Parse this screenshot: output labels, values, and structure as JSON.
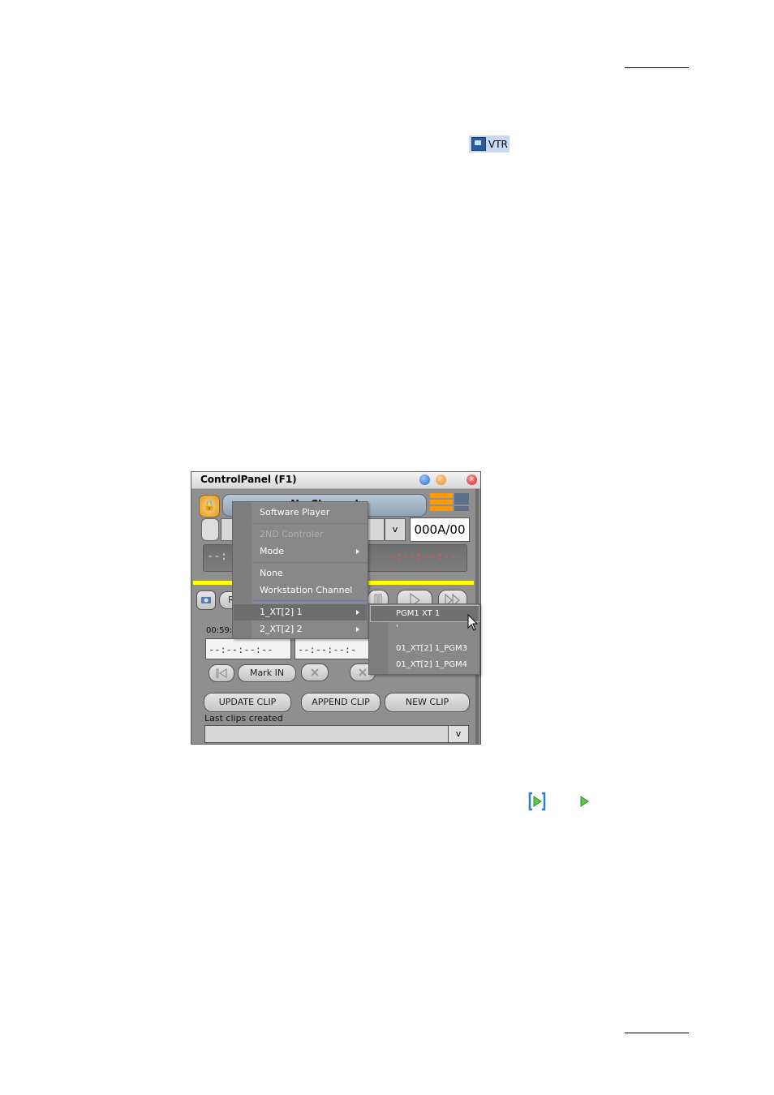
{
  "inline_icon": {
    "label": "VTR"
  },
  "window": {
    "title": "ControlPanel (F1)",
    "close_glyph": "x",
    "channel_label": "No Channel",
    "clip_id": "000A/00",
    "clip_dropdown": "v",
    "timecode_left": "--:",
    "timecode_right": "-:--:--:--",
    "record_btn": "R",
    "tc_small": "00:59:5",
    "tc_in": "--:--:--:--",
    "tc_out": "--:--:--:-",
    "mark_in": "Mark IN",
    "update_clip": "UPDATE CLIP",
    "append_clip": "APPEND CLIP",
    "new_clip": "NEW CLIP",
    "last_clips_label": "Last clips created",
    "last_clips_dropdown": "v"
  },
  "context_menu": {
    "items": [
      {
        "label": "Software Player",
        "enabled": true
      },
      {
        "label": "2ND Controler",
        "enabled": false
      },
      {
        "label": "Mode",
        "enabled": true,
        "submenu": true
      },
      {
        "label": "None",
        "enabled": true
      },
      {
        "label": "Workstation Channel",
        "enabled": true
      },
      {
        "label": "1_XT[2] 1",
        "enabled": true,
        "submenu": true,
        "highlighted": true
      },
      {
        "label": "2_XT[2] 2",
        "enabled": true,
        "submenu": true
      }
    ]
  },
  "sub_menu": {
    "items": [
      {
        "label": "PGM1 XT 1",
        "highlighted": true
      },
      {
        "label": "'"
      },
      {
        "label": "01_XT[2] 1_PGM3"
      },
      {
        "label": "01_XT[2] 1_PGM4"
      }
    ]
  },
  "colors": {
    "level_bar": "#ff9a00",
    "status_bar": "#ffff00",
    "window_bg": "#8f8f8f"
  }
}
